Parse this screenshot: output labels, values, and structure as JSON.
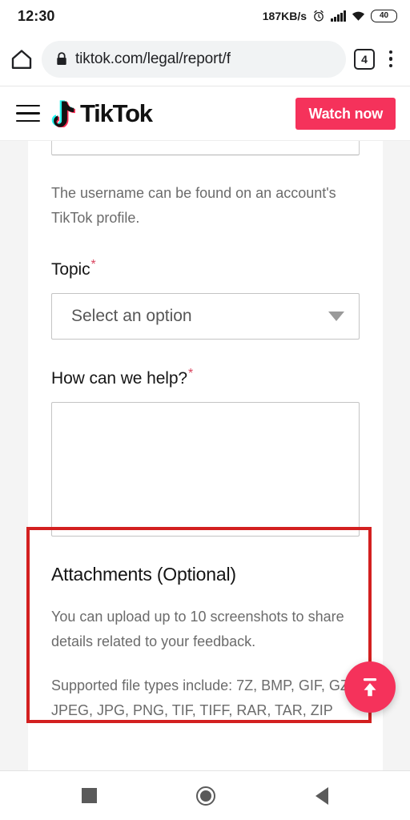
{
  "status_bar": {
    "clock": "12:30",
    "network_speed": "187KB/s",
    "battery_level": "40",
    "icons": [
      "alarm-icon",
      "signal-icon",
      "wifi-icon",
      "battery-icon"
    ]
  },
  "browser": {
    "url": "tiktok.com/legal/report/f",
    "tab_count": "4",
    "icons": [
      "home-icon",
      "lock-icon",
      "tab-switcher-icon",
      "overflow-menu-icon"
    ]
  },
  "site_header": {
    "logo_text": "TikTok",
    "menu_icon": "hamburger-icon",
    "cta_label": "Watch now",
    "brand_color": "#f5325b"
  },
  "form": {
    "username_help_text": "The username can be found on an account's TikTok profile.",
    "topic": {
      "label": "Topic",
      "required_marker": "*",
      "placeholder": "Select an option",
      "caret_icon": "chevron-down-icon"
    },
    "how_can_we_help": {
      "label": "How can we help?",
      "required_marker": "*",
      "value": ""
    },
    "attachments": {
      "title": "Attachments (Optional)",
      "upload_limit_text": "You can upload up to 10 screenshots to share details related to your feedback.",
      "supported_types_text": "Supported file types include: 7Z, BMP, GIF, GZ, JPEG, JPG, PNG, TIF, TIFF, RAR, TAR, ZIP"
    }
  },
  "annotation": {
    "color": "#d32020",
    "target": "how-can-we-help-field"
  },
  "fab": {
    "icon": "upload-to-top-icon",
    "color": "#f5325b"
  },
  "android_nav": {
    "recents_icon": "recents-square-icon",
    "home_icon": "home-circle-icon",
    "back_icon": "back-triangle-icon"
  }
}
